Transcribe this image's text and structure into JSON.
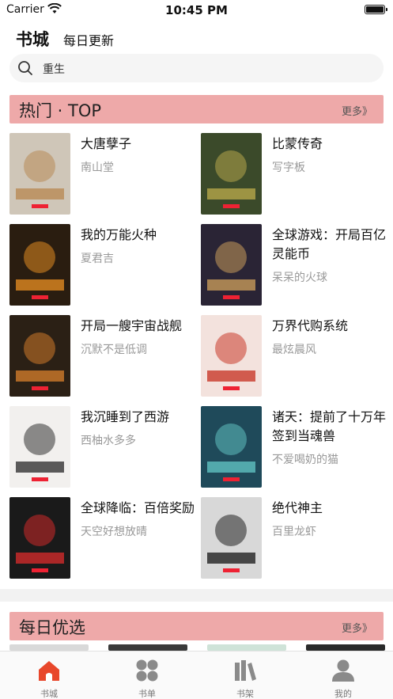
{
  "status_bar": {
    "carrier": "Carrier",
    "time": "10:45 PM"
  },
  "header": {
    "title": "书城",
    "subtitle": "每日更新"
  },
  "search": {
    "value": "重生"
  },
  "hot_section": {
    "title": "热门 · TOP",
    "more": "更多》",
    "books": [
      {
        "title": "大唐孽子",
        "author": "南山堂",
        "cover_bg": "#cfc6b8",
        "cover_accent": "#b88a55"
      },
      {
        "title": "比蒙传奇",
        "author": "写字板",
        "cover_bg": "#3b4a2a",
        "cover_accent": "#b6a64a"
      },
      {
        "title": "我的万能火种",
        "author": "夏君吉",
        "cover_bg": "#2a1d10",
        "cover_accent": "#e08a20"
      },
      {
        "title": "全球游戏：开局百亿灵能币",
        "author": "呆呆的火球",
        "cover_bg": "#2a2435",
        "cover_accent": "#c79a5a"
      },
      {
        "title": "开局一艘宇宙战舰",
        "author": "沉默不是低调",
        "cover_bg": "#2b2015",
        "cover_accent": "#d07a2a"
      },
      {
        "title": "万界代购系统",
        "author": "最炫晨风",
        "cover_bg": "#f3e2dd",
        "cover_accent": "#c83a2a"
      },
      {
        "title": "我沉睡到了西游",
        "author": "西柚水多多",
        "cover_bg": "#f2f0ee",
        "cover_accent": "#333333"
      },
      {
        "title": "诸天：提前了十万年签到当魂兽",
        "author": "不爱喝奶的猫",
        "cover_bg": "#1f4a5a",
        "cover_accent": "#5fc0c0"
      },
      {
        "title": "全球降临：百倍奖励",
        "author": "天空好想放晴",
        "cover_bg": "#1a1a1a",
        "cover_accent": "#d02a2a"
      },
      {
        "title": "绝代神主",
        "author": "百里龙虾",
        "cover_bg": "#d8d8d8",
        "cover_accent": "#222222"
      }
    ]
  },
  "daily_section": {
    "title": "每日优选",
    "more": "更多》"
  },
  "tabbar": {
    "items": [
      {
        "label": "书城",
        "icon": "house-icon",
        "active": true
      },
      {
        "label": "书单",
        "icon": "grid-icon",
        "active": false
      },
      {
        "label": "书架",
        "icon": "bookshelf-icon",
        "active": false
      },
      {
        "label": "我的",
        "icon": "person-icon",
        "active": false
      }
    ],
    "active_color": "#e8472b",
    "inactive_color": "#8a8a8a"
  }
}
